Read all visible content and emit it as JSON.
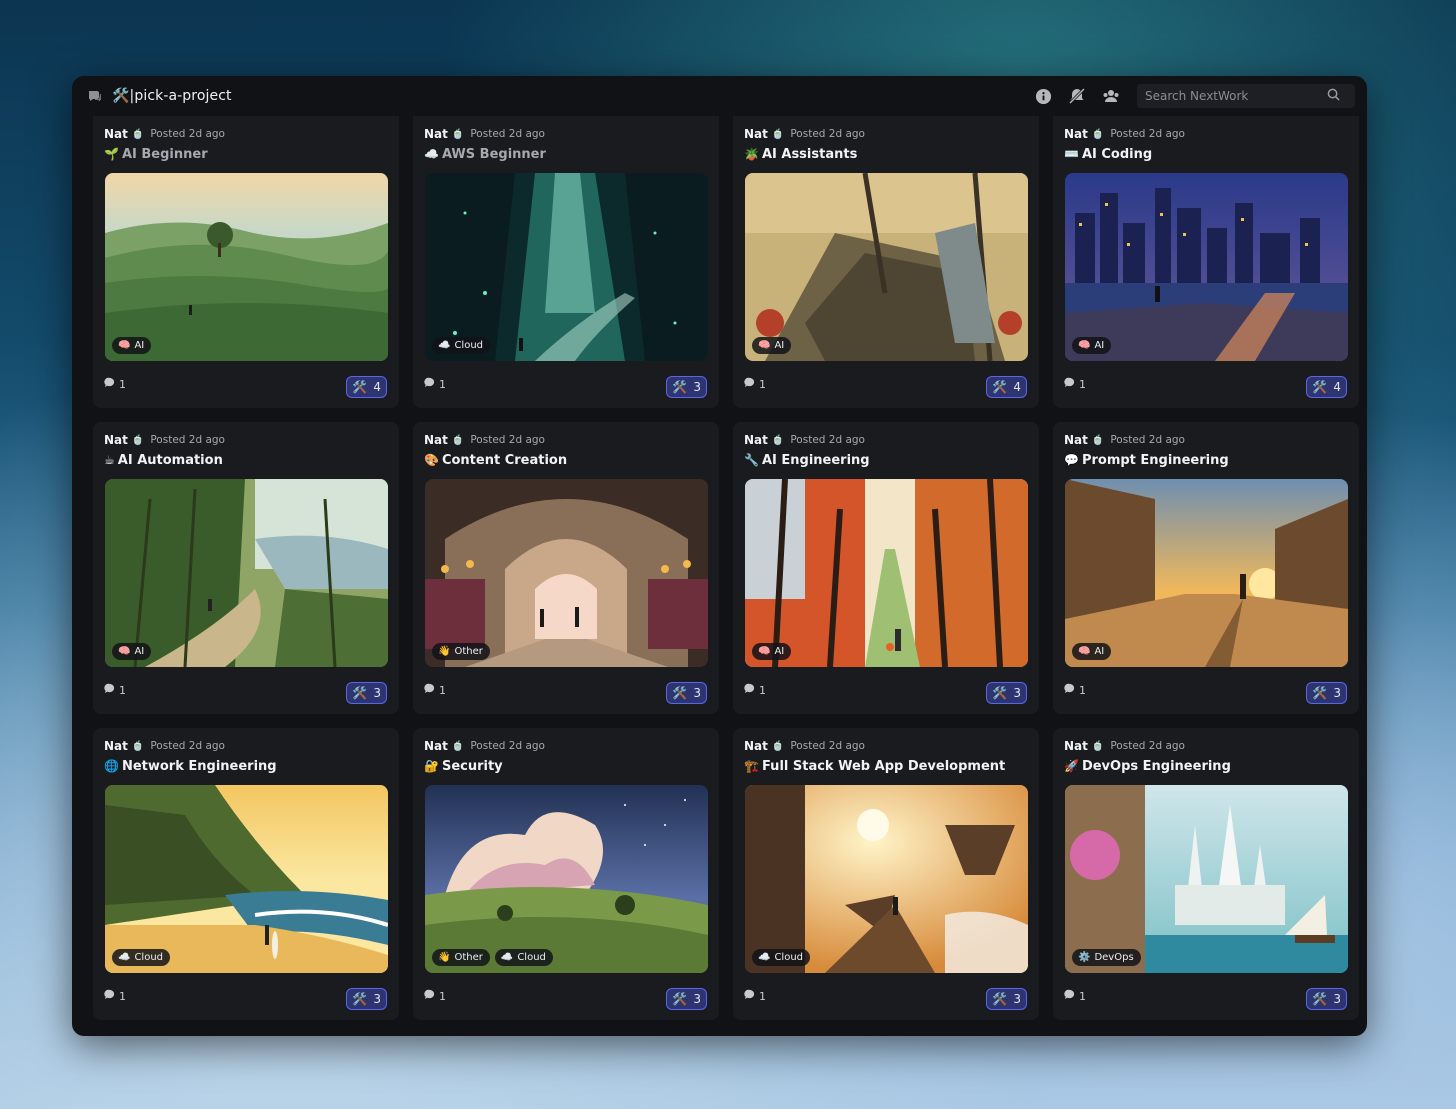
{
  "channel": {
    "name": "🛠️|pick-a-project",
    "icon": "forum-icon"
  },
  "search": {
    "placeholder": "Search NextWork"
  },
  "toolbar_icons": [
    "info-icon",
    "notifications-off-icon",
    "members-icon"
  ],
  "posts": [
    {
      "author": "Nat",
      "badge": "🍵",
      "posted": "Posted 2d ago",
      "emoji": "🌱",
      "title": "AI Beginner",
      "title_muted": true,
      "tags": [
        {
          "icon": "🧠",
          "label": "AI"
        }
      ],
      "replies": "1",
      "reaction_emoji": "🛠️",
      "reaction_count": "4",
      "scene": "hills"
    },
    {
      "author": "Nat",
      "badge": "🍵",
      "posted": "Posted 2d ago",
      "emoji": "☁️",
      "title": "AWS Beginner",
      "title_muted": true,
      "tags": [
        {
          "icon": "☁️",
          "label": "Cloud"
        }
      ],
      "replies": "1",
      "reaction_emoji": "🛠️",
      "reaction_count": "3",
      "scene": "cave"
    },
    {
      "author": "Nat",
      "badge": "🍵",
      "posted": "Posted 2d ago",
      "emoji": "🪴",
      "title": "AI Assistants",
      "title_muted": false,
      "tags": [
        {
          "icon": "🧠",
          "label": "AI"
        }
      ],
      "replies": "1",
      "reaction_emoji": "🛠️",
      "reaction_count": "4",
      "scene": "shipwreck"
    },
    {
      "author": "Nat",
      "badge": "🍵",
      "posted": "Posted 2d ago",
      "emoji": "⌨️",
      "title": "AI Coding",
      "title_muted": false,
      "tags": [
        {
          "icon": "🧠",
          "label": "AI"
        }
      ],
      "replies": "1",
      "reaction_emoji": "🛠️",
      "reaction_count": "4",
      "scene": "city"
    },
    {
      "author": "Nat",
      "badge": "🍵",
      "posted": "Posted 2d ago",
      "emoji": "☕",
      "title": "AI Automation",
      "title_muted": false,
      "tags": [
        {
          "icon": "🧠",
          "label": "AI"
        }
      ],
      "replies": "1",
      "reaction_emoji": "🛠️",
      "reaction_count": "3",
      "scene": "jungle"
    },
    {
      "author": "Nat",
      "badge": "🍵",
      "posted": "Posted 2d ago",
      "emoji": "🎨",
      "title": "Content Creation",
      "title_muted": false,
      "tags": [
        {
          "icon": "👋",
          "label": "Other"
        }
      ],
      "replies": "1",
      "reaction_emoji": "🛠️",
      "reaction_count": "3",
      "scene": "bazaar"
    },
    {
      "author": "Nat",
      "badge": "🍵",
      "posted": "Posted 2d ago",
      "emoji": "🔧",
      "title": "AI Engineering",
      "title_muted": false,
      "tags": [
        {
          "icon": "🧠",
          "label": "AI"
        }
      ],
      "replies": "1",
      "reaction_emoji": "🛠️",
      "reaction_count": "3",
      "scene": "autumn"
    },
    {
      "author": "Nat",
      "badge": "🍵",
      "posted": "Posted 2d ago",
      "emoji": "💬",
      "title": "Prompt Engineering",
      "title_muted": false,
      "tags": [
        {
          "icon": "🧠",
          "label": "AI"
        }
      ],
      "replies": "1",
      "reaction_emoji": "🛠️",
      "reaction_count": "3",
      "scene": "western"
    },
    {
      "author": "Nat",
      "badge": "🍵",
      "posted": "Posted 2d ago",
      "emoji": "🌐",
      "title": "Network Engineering",
      "title_muted": false,
      "tags": [
        {
          "icon": "☁️",
          "label": "Cloud"
        }
      ],
      "replies": "1",
      "reaction_emoji": "🛠️",
      "reaction_count": "3",
      "scene": "beach"
    },
    {
      "author": "Nat",
      "badge": "🍵",
      "posted": "Posted 2d ago",
      "emoji": "🔐",
      "title": "Security",
      "title_muted": false,
      "tags": [
        {
          "icon": "👋",
          "label": "Other"
        },
        {
          "icon": "☁️",
          "label": "Cloud"
        }
      ],
      "replies": "1",
      "reaction_emoji": "🛠️",
      "reaction_count": "3",
      "scene": "sky"
    },
    {
      "author": "Nat",
      "badge": "🍵",
      "posted": "Posted 2d ago",
      "emoji": "🏗️",
      "title": "Full Stack Web App Development",
      "title_muted": false,
      "tags": [
        {
          "icon": "☁️",
          "label": "Cloud"
        }
      ],
      "replies": "1",
      "reaction_emoji": "🛠️",
      "reaction_count": "3",
      "scene": "floating"
    },
    {
      "author": "Nat",
      "badge": "🍵",
      "posted": "Posted 2d ago",
      "emoji": "🚀",
      "title": "DevOps Engineering",
      "title_muted": false,
      "tags": [
        {
          "icon": "⚙️",
          "label": "DevOps"
        }
      ],
      "replies": "1",
      "reaction_emoji": "🛠️",
      "reaction_count": "3",
      "scene": "castle"
    }
  ]
}
